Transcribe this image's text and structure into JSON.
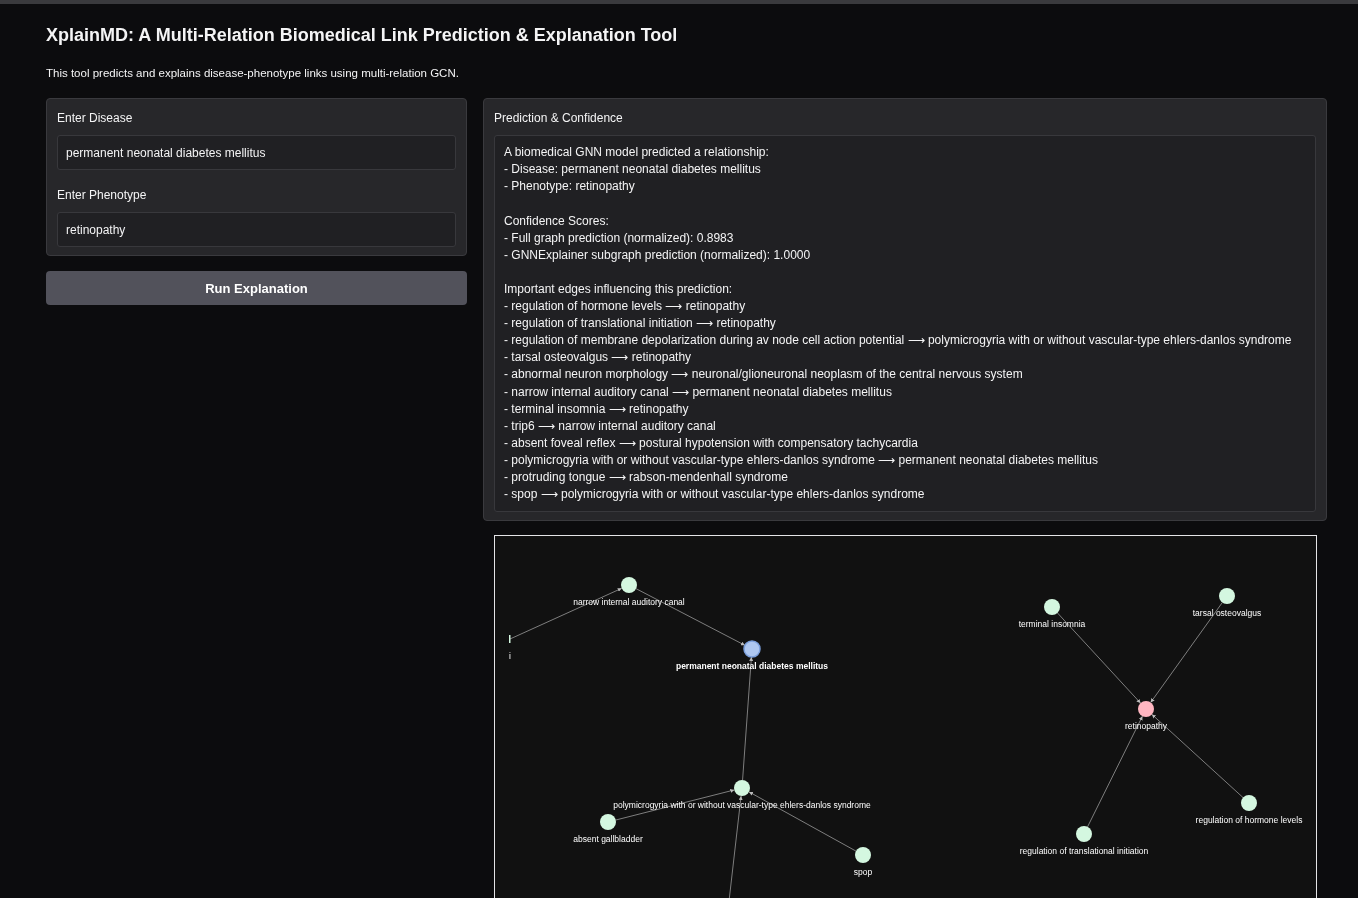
{
  "title": "XplainMD: A Multi-Relation Biomedical Link Prediction & Explanation Tool",
  "description": "This tool predicts and explains disease-phenotype links using multi-relation GCN.",
  "inputs": [
    {
      "label": "Enter Disease",
      "value": "permanent neonatal diabetes mellitus"
    },
    {
      "label": "Enter Phenotype",
      "value": "retinopathy"
    }
  ],
  "run_button": "Run Explanation",
  "output": {
    "label": "Prediction & Confidence",
    "paragraphs": [
      [
        "A biomedical GNN model predicted a relationship:",
        "- Disease: permanent neonatal diabetes mellitus",
        "- Phenotype: retinopathy"
      ],
      [
        "Confidence Scores:",
        "- Full graph prediction (normalized): 0.8983",
        "- GNNExplainer subgraph prediction (normalized): 1.0000"
      ],
      [
        "Important edges influencing this prediction:",
        "- regulation of hormone levels ⟶ retinopathy",
        "- regulation of translational initiation ⟶ retinopathy",
        "- regulation of membrane depolarization during av node cell action potential ⟶ polymicrogyria with or without vascular-type ehlers-danlos syndrome",
        "- tarsal osteovalgus ⟶ retinopathy",
        "- abnormal neuron morphology ⟶ neuronal/glioneuronal neoplasm of the central nervous system",
        "- narrow internal auditory canal ⟶ permanent neonatal diabetes mellitus",
        "- terminal insomnia ⟶ retinopathy",
        "- trip6 ⟶ narrow internal auditory canal",
        "- absent foveal reflex ⟶ postural hypotension with compensatory tachycardia",
        "- polymicrogyria with or without vascular-type ehlers-danlos syndrome ⟶ permanent neonatal diabetes mellitus",
        "- protruding tongue ⟶ rabson-mendenhall syndrome",
        "- spop ⟶ polymicrogyria with or without vascular-type ehlers-danlos syndrome"
      ]
    ]
  },
  "graph": {
    "nodes": [
      {
        "label": "i",
        "color": "#d4f7e0",
        "kind": "stub"
      },
      {
        "label": "narrow internal auditory canal",
        "color": "#d4f7e0",
        "kind": "node"
      },
      {
        "label": "permanent neonatal diabetes mellitus",
        "color": "#aec7f0",
        "kind": "query"
      },
      {
        "label": "polymicrogyria with or without vascular-type ehlers-danlos syndrome",
        "color": "#d4f7e0",
        "kind": "node"
      },
      {
        "label": "absent gallbladder",
        "color": "#d4f7e0",
        "kind": "node"
      },
      {
        "label": "spop",
        "color": "#d4f7e0",
        "kind": "node"
      },
      {
        "label": "terminal insomnia",
        "color": "#d4f7e0",
        "kind": "node"
      },
      {
        "label": "tarsal osteovalgus",
        "color": "#d4f7e0",
        "kind": "node"
      },
      {
        "label": "retinopathy",
        "color": "#ffb6c1",
        "kind": "query"
      },
      {
        "label": "regulation of hormone levels",
        "color": "#d4f7e0",
        "kind": "node"
      },
      {
        "label": "regulation of translational initiation",
        "color": "#d4f7e0",
        "kind": "node"
      }
    ]
  }
}
